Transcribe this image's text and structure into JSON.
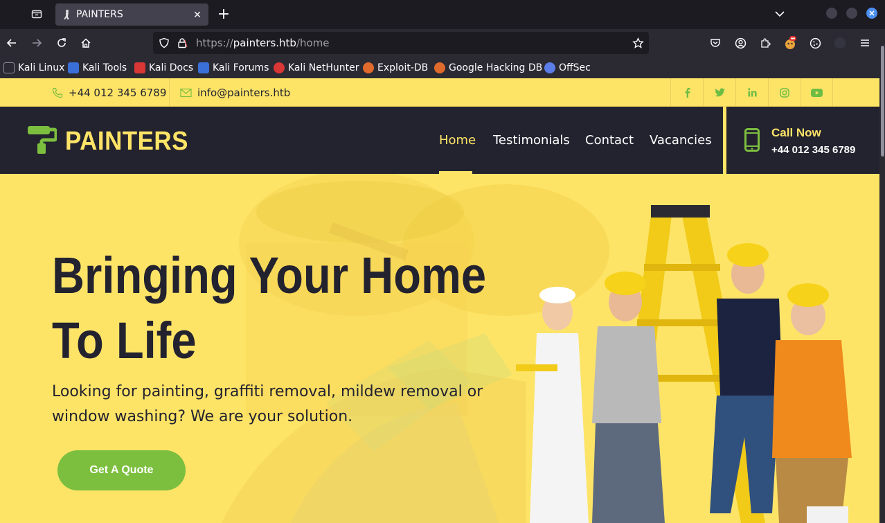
{
  "browser": {
    "tab_title": "PAINTERS",
    "url_scheme": "https://",
    "url_host": "painters.htb",
    "url_path": "/home",
    "bookmarks": [
      {
        "label": "Kali Linux",
        "color": "#2b2a33"
      },
      {
        "label": "Kali Tools",
        "color": "#3a6fd8"
      },
      {
        "label": "Kali Docs",
        "color": "#d93636"
      },
      {
        "label": "Kali Forums",
        "color": "#3a6fd8"
      },
      {
        "label": "Kali NetHunter",
        "color": "#d93636"
      },
      {
        "label": "Exploit-DB",
        "color": "#e06a2c"
      },
      {
        "label": "Google Hacking DB",
        "color": "#e06a2c"
      },
      {
        "label": "OffSec",
        "color": "#5b7de8"
      }
    ]
  },
  "topbar": {
    "phone": "+44 012 345 6789",
    "email": "info@painters.htb",
    "social": [
      "facebook-icon",
      "twitter-icon",
      "linkedin-icon",
      "instagram-icon",
      "youtube-icon"
    ]
  },
  "nav": {
    "logo": "PAINTERS",
    "links": [
      "Home",
      "Testimonials",
      "Contact",
      "Vacancies"
    ],
    "active": "Home",
    "call_title": "Call Now",
    "call_number": "+44 012 345 6789"
  },
  "hero": {
    "heading": "Bringing Your Home To Life",
    "subheading": "Looking for painting, graffiti removal, mildew removal or window washing? We are your solution.",
    "cta": "Get A Quote"
  },
  "colors": {
    "accent_yellow": "#fde467",
    "accent_green": "#7cbf3f",
    "dark": "#23222f"
  }
}
